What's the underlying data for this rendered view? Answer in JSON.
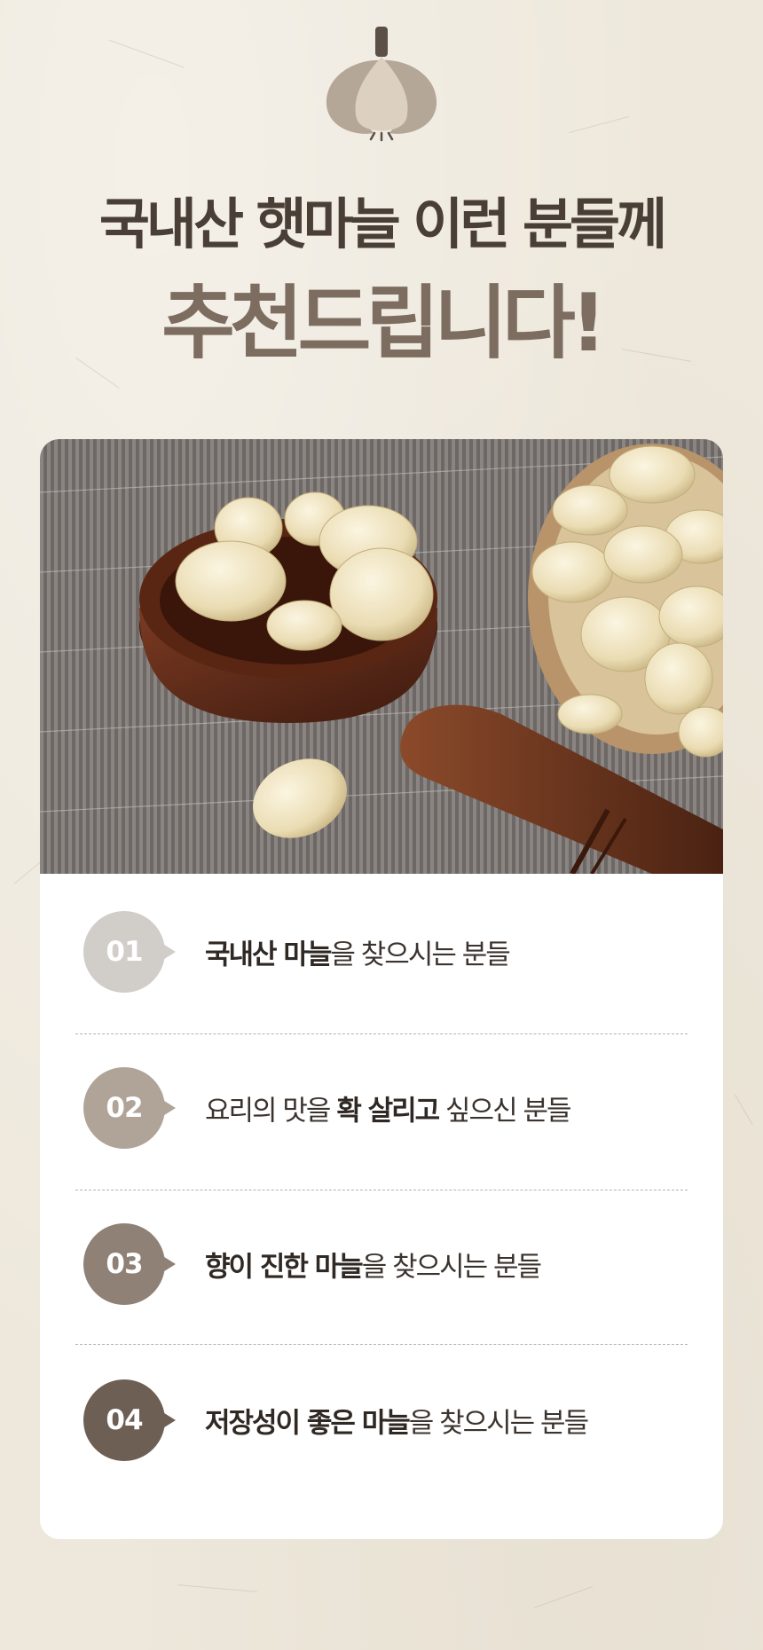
{
  "logo": {
    "icon": "garlic-icon",
    "colors": [
      "#5c4f45",
      "#b5a797",
      "#dcd0c1"
    ]
  },
  "headline": {
    "line1": "국내산 햇마늘 이런 분들께",
    "line2": "추천드립니다!"
  },
  "photo": {
    "alt": ""
  },
  "items": [
    {
      "number": "01",
      "badge_color": "#d1cdc8",
      "parts": [
        {
          "text": "국내산 마늘",
          "bold": true
        },
        {
          "text": "을 찾으시는 분들",
          "bold": false
        }
      ]
    },
    {
      "number": "02",
      "badge_color": "#b0a398",
      "parts": [
        {
          "text": "요리의 맛을 ",
          "bold": false
        },
        {
          "text": "확 살리고",
          "bold": true
        },
        {
          "text": " 싶으신 분들",
          "bold": false
        }
      ]
    },
    {
      "number": "03",
      "badge_color": "#8f8175",
      "parts": [
        {
          "text": "향이 진한 마늘",
          "bold": true
        },
        {
          "text": "을 찾으시는 분들",
          "bold": false
        }
      ]
    },
    {
      "number": "04",
      "badge_color": "#6e5f54",
      "parts": [
        {
          "text": "저장성이 좋은 마늘",
          "bold": true
        },
        {
          "text": "을 찾으시는 분들",
          "bold": false
        }
      ]
    }
  ]
}
